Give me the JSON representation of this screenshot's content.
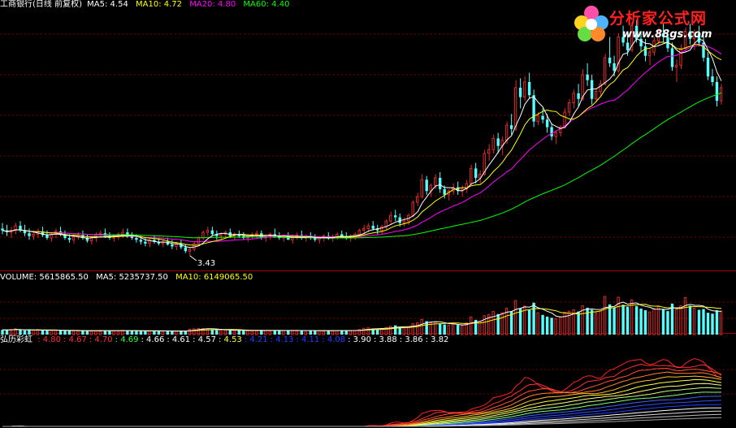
{
  "colors": {
    "background": "#000000",
    "up": "#e02a2a",
    "down": "#54ffff",
    "ma5": "#ffffff",
    "ma10": "#ffff00",
    "ma20": "#ff00ff",
    "ma60": "#00ff00",
    "grid": "#800000",
    "divider": "#a00000"
  },
  "header": {
    "title": "工商银行(日线 前复权)",
    "ma5": "MA5: 4.54",
    "ma10": "MA10: 4.72",
    "ma20": "MA20: 4.80",
    "ma60": "MA60: 4.40"
  },
  "volume_header": {
    "volume": "VOLUME: 5615865.50",
    "ma5": "MA5: 5235737.50",
    "ma10": "MA10: 6149065.50"
  },
  "indicator_header": {
    "name": "弘历彩虹",
    "values": [
      {
        "text": ": 4.80",
        "color": "#ff3030"
      },
      {
        "text": ": 4.67",
        "color": "#ff3030"
      },
      {
        "text": ": 4.70",
        "color": "#ff3030"
      },
      {
        "text": ": 4.69",
        "color": "#30ff30"
      },
      {
        "text": ": 4.66",
        "color": "#ffffff"
      },
      {
        "text": ": 4.61",
        "color": "#ffffff"
      },
      {
        "text": ": 4.57",
        "color": "#ffffff"
      },
      {
        "text": ": 4.53",
        "color": "#ffff40"
      },
      {
        "text": ": 4.21",
        "color": "#2040ff"
      },
      {
        "text": ": 4.13",
        "color": "#2040ff"
      },
      {
        "text": ": 4.11",
        "color": "#2040ff"
      },
      {
        "text": ": 4.08",
        "color": "#2040ff"
      },
      {
        "text": ": 3.90",
        "color": "#ffffff"
      },
      {
        "text": ": 3.88",
        "color": "#ffffff"
      },
      {
        "text": ": 3.86",
        "color": "#ffffff"
      },
      {
        "text": ": 3.82",
        "color": "#ffffff"
      }
    ]
  },
  "logo": {
    "title": "分析家公式网",
    "url": "www.88gs.com"
  },
  "low_label": "3.43",
  "chart_data": [
    {
      "type": "candlestick",
      "name": "price",
      "ylim": [
        3.3,
        6.05
      ],
      "low_annotation": {
        "index": 42,
        "value": 3.43,
        "label": "3.43"
      },
      "ohlc": [
        [
          3.72,
          3.78,
          3.66,
          3.7
        ],
        [
          3.7,
          3.76,
          3.64,
          3.68
        ],
        [
          3.68,
          3.74,
          3.62,
          3.7
        ],
        [
          3.7,
          3.78,
          3.66,
          3.75
        ],
        [
          3.75,
          3.8,
          3.68,
          3.7
        ],
        [
          3.7,
          3.76,
          3.64,
          3.67
        ],
        [
          3.67,
          3.72,
          3.6,
          3.64
        ],
        [
          3.64,
          3.7,
          3.6,
          3.66
        ],
        [
          3.66,
          3.72,
          3.62,
          3.69
        ],
        [
          3.69,
          3.74,
          3.63,
          3.65
        ],
        [
          3.65,
          3.7,
          3.6,
          3.62
        ],
        [
          3.62,
          3.68,
          3.58,
          3.66
        ],
        [
          3.66,
          3.72,
          3.62,
          3.69
        ],
        [
          3.69,
          3.74,
          3.64,
          3.66
        ],
        [
          3.66,
          3.7,
          3.6,
          3.62
        ],
        [
          3.62,
          3.66,
          3.57,
          3.6
        ],
        [
          3.6,
          3.66,
          3.56,
          3.63
        ],
        [
          3.63,
          3.68,
          3.6,
          3.65
        ],
        [
          3.65,
          3.7,
          3.6,
          3.62
        ],
        [
          3.62,
          3.66,
          3.57,
          3.59
        ],
        [
          3.59,
          3.64,
          3.55,
          3.62
        ],
        [
          3.62,
          3.68,
          3.58,
          3.65
        ],
        [
          3.65,
          3.7,
          3.62,
          3.67
        ],
        [
          3.67,
          3.72,
          3.62,
          3.64
        ],
        [
          3.64,
          3.68,
          3.6,
          3.62
        ],
        [
          3.62,
          3.66,
          3.58,
          3.63
        ],
        [
          3.63,
          3.68,
          3.6,
          3.66
        ],
        [
          3.66,
          3.72,
          3.62,
          3.68
        ],
        [
          3.68,
          3.72,
          3.62,
          3.64
        ],
        [
          3.64,
          3.68,
          3.6,
          3.62
        ],
        [
          3.62,
          3.66,
          3.57,
          3.6
        ],
        [
          3.6,
          3.64,
          3.55,
          3.58
        ],
        [
          3.58,
          3.62,
          3.53,
          3.56
        ],
        [
          3.56,
          3.62,
          3.52,
          3.6
        ],
        [
          3.6,
          3.65,
          3.56,
          3.58
        ],
        [
          3.58,
          3.62,
          3.54,
          3.56
        ],
        [
          3.56,
          3.6,
          3.52,
          3.58
        ],
        [
          3.58,
          3.62,
          3.54,
          3.55
        ],
        [
          3.55,
          3.6,
          3.5,
          3.53
        ],
        [
          3.53,
          3.58,
          3.49,
          3.56
        ],
        [
          3.56,
          3.6,
          3.5,
          3.52
        ],
        [
          3.52,
          3.55,
          3.46,
          3.48
        ],
        [
          3.48,
          3.52,
          3.43,
          3.5
        ],
        [
          3.5,
          3.58,
          3.48,
          3.56
        ],
        [
          3.56,
          3.64,
          3.54,
          3.62
        ],
        [
          3.62,
          3.7,
          3.6,
          3.68
        ],
        [
          3.68,
          3.74,
          3.64,
          3.7
        ],
        [
          3.7,
          3.74,
          3.64,
          3.66
        ],
        [
          3.66,
          3.7,
          3.6,
          3.64
        ],
        [
          3.64,
          3.68,
          3.6,
          3.66
        ],
        [
          3.66,
          3.7,
          3.62,
          3.68
        ],
        [
          3.68,
          3.72,
          3.62,
          3.64
        ],
        [
          3.64,
          3.68,
          3.6,
          3.66
        ],
        [
          3.66,
          3.7,
          3.62,
          3.64
        ],
        [
          3.64,
          3.68,
          3.6,
          3.62
        ],
        [
          3.62,
          3.66,
          3.58,
          3.64
        ],
        [
          3.64,
          3.68,
          3.6,
          3.66
        ],
        [
          3.66,
          3.7,
          3.62,
          3.67
        ],
        [
          3.67,
          3.7,
          3.6,
          3.62
        ],
        [
          3.62,
          3.66,
          3.58,
          3.64
        ],
        [
          3.64,
          3.68,
          3.6,
          3.66
        ],
        [
          3.66,
          3.72,
          3.62,
          3.64
        ],
        [
          3.64,
          3.68,
          3.6,
          3.62
        ],
        [
          3.62,
          3.66,
          3.58,
          3.64
        ],
        [
          3.64,
          3.68,
          3.6,
          3.6
        ],
        [
          3.6,
          3.66,
          3.56,
          3.63
        ],
        [
          3.63,
          3.68,
          3.6,
          3.65
        ],
        [
          3.65,
          3.7,
          3.6,
          3.62
        ],
        [
          3.62,
          3.66,
          3.58,
          3.64
        ],
        [
          3.64,
          3.68,
          3.6,
          3.62
        ],
        [
          3.62,
          3.66,
          3.58,
          3.6
        ],
        [
          3.6,
          3.64,
          3.56,
          3.62
        ],
        [
          3.62,
          3.66,
          3.58,
          3.64
        ],
        [
          3.64,
          3.68,
          3.6,
          3.62
        ],
        [
          3.62,
          3.66,
          3.58,
          3.63
        ],
        [
          3.63,
          3.68,
          3.6,
          3.66
        ],
        [
          3.66,
          3.7,
          3.62,
          3.64
        ],
        [
          3.64,
          3.68,
          3.6,
          3.62
        ],
        [
          3.62,
          3.66,
          3.58,
          3.64
        ],
        [
          3.64,
          3.68,
          3.6,
          3.66
        ],
        [
          3.66,
          3.72,
          3.62,
          3.7
        ],
        [
          3.7,
          3.76,
          3.66,
          3.72
        ],
        [
          3.72,
          3.78,
          3.68,
          3.75
        ],
        [
          3.75,
          3.8,
          3.7,
          3.72
        ],
        [
          3.72,
          3.76,
          3.66,
          3.7
        ],
        [
          3.7,
          3.76,
          3.66,
          3.74
        ],
        [
          3.74,
          3.82,
          3.7,
          3.8
        ],
        [
          3.8,
          3.9,
          3.76,
          3.86
        ],
        [
          3.86,
          3.92,
          3.8,
          3.84
        ],
        [
          3.84,
          3.88,
          3.74,
          3.78
        ],
        [
          3.78,
          3.84,
          3.74,
          3.8
        ],
        [
          3.8,
          3.88,
          3.76,
          3.86
        ],
        [
          3.86,
          4.02,
          3.84,
          4.0
        ],
        [
          4.0,
          4.1,
          3.96,
          4.06
        ],
        [
          4.06,
          4.3,
          4.04,
          4.24
        ],
        [
          4.24,
          4.28,
          4.08,
          4.12
        ],
        [
          4.12,
          4.2,
          4.06,
          4.18
        ],
        [
          4.18,
          4.3,
          4.14,
          4.26
        ],
        [
          4.26,
          4.32,
          4.1,
          4.14
        ],
        [
          4.14,
          4.18,
          4.04,
          4.08
        ],
        [
          4.08,
          4.14,
          4.02,
          4.12
        ],
        [
          4.12,
          4.2,
          4.08,
          4.16
        ],
        [
          4.16,
          4.22,
          4.08,
          4.12
        ],
        [
          4.12,
          4.18,
          4.06,
          4.14
        ],
        [
          4.14,
          4.24,
          4.1,
          4.2
        ],
        [
          4.2,
          4.4,
          4.18,
          4.36
        ],
        [
          4.36,
          4.42,
          4.2,
          4.26
        ],
        [
          4.26,
          4.34,
          4.2,
          4.3
        ],
        [
          4.3,
          4.56,
          4.28,
          4.52
        ],
        [
          4.52,
          4.62,
          4.44,
          4.56
        ],
        [
          4.56,
          4.72,
          4.52,
          4.68
        ],
        [
          4.68,
          4.74,
          4.52,
          4.6
        ],
        [
          4.6,
          4.7,
          4.5,
          4.66
        ],
        [
          4.66,
          4.86,
          4.62,
          4.82
        ],
        [
          4.82,
          4.94,
          4.72,
          4.78
        ],
        [
          4.78,
          5.3,
          4.76,
          5.22
        ],
        [
          5.22,
          5.32,
          5.0,
          5.12
        ],
        [
          5.12,
          5.34,
          5.08,
          5.28
        ],
        [
          5.28,
          5.38,
          5.1,
          5.14
        ],
        [
          5.14,
          5.2,
          4.8,
          4.86
        ],
        [
          4.86,
          4.96,
          4.82,
          4.92
        ],
        [
          4.92,
          5.0,
          4.84,
          4.88
        ],
        [
          4.88,
          4.94,
          4.74,
          4.8
        ],
        [
          4.8,
          4.84,
          4.66,
          4.7
        ],
        [
          4.7,
          4.76,
          4.62,
          4.74
        ],
        [
          4.74,
          4.82,
          4.7,
          4.8
        ],
        [
          4.8,
          5.0,
          4.78,
          4.96
        ],
        [
          4.96,
          5.1,
          4.92,
          5.06
        ],
        [
          5.06,
          5.2,
          5.0,
          5.16
        ],
        [
          5.16,
          5.26,
          5.02,
          5.1
        ],
        [
          5.1,
          5.42,
          5.08,
          5.36
        ],
        [
          5.36,
          5.48,
          5.24,
          5.3
        ],
        [
          5.3,
          5.36,
          5.04,
          5.1
        ],
        [
          5.1,
          5.22,
          5.06,
          5.18
        ],
        [
          5.18,
          5.3,
          5.12,
          5.26
        ],
        [
          5.26,
          5.58,
          5.24,
          5.54
        ],
        [
          5.54,
          5.76,
          5.44,
          5.48
        ],
        [
          5.48,
          5.56,
          5.34,
          5.4
        ],
        [
          5.4,
          5.8,
          5.38,
          5.76
        ],
        [
          5.76,
          5.88,
          5.66,
          5.7
        ],
        [
          5.7,
          5.82,
          5.56,
          5.62
        ],
        [
          5.62,
          5.92,
          5.6,
          5.88
        ],
        [
          5.88,
          5.94,
          5.7,
          5.74
        ],
        [
          5.74,
          5.82,
          5.6,
          5.66
        ],
        [
          5.66,
          5.74,
          5.5,
          5.56
        ],
        [
          5.56,
          5.64,
          5.46,
          5.6
        ],
        [
          5.6,
          5.76,
          5.56,
          5.72
        ],
        [
          5.72,
          5.86,
          5.66,
          5.8
        ],
        [
          5.8,
          5.9,
          5.7,
          5.76
        ],
        [
          5.76,
          5.8,
          5.6,
          5.64
        ],
        [
          5.64,
          5.7,
          5.4,
          5.44
        ],
        [
          5.44,
          5.52,
          5.28,
          5.46
        ],
        [
          5.46,
          5.68,
          5.42,
          5.64
        ],
        [
          5.64,
          5.86,
          5.6,
          5.82
        ],
        [
          5.82,
          5.9,
          5.68,
          5.74
        ],
        [
          5.74,
          5.84,
          5.62,
          5.8
        ],
        [
          5.8,
          5.88,
          5.66,
          5.7
        ],
        [
          5.7,
          5.78,
          5.5,
          5.54
        ],
        [
          5.54,
          5.6,
          5.3,
          5.34
        ],
        [
          5.34,
          5.42,
          5.24,
          5.28
        ],
        [
          5.28,
          5.34,
          5.02,
          5.08
        ],
        [
          5.08,
          5.26,
          5.04,
          5.22
        ]
      ]
    },
    {
      "type": "bar",
      "name": "volume",
      "ylim": [
        0,
        12000000
      ],
      "ma": [
        {
          "name": "MA5",
          "value": 5235737.5
        },
        {
          "name": "MA10",
          "value": 6149065.5
        }
      ],
      "values": [
        1150000,
        1080000,
        1220000,
        1350000,
        1120000,
        980000,
        1100000,
        1050000,
        1180000,
        1000000,
        950000,
        1020000,
        1100000,
        980000,
        900000,
        880000,
        940000,
        1000000,
        920000,
        870000,
        900000,
        960000,
        1020000,
        980000,
        920000,
        900000,
        940000,
        1000000,
        960000,
        910000,
        880000,
        860000,
        840000,
        900000,
        880000,
        850000,
        870000,
        840000,
        820000,
        860000,
        830000,
        800000,
        1300000,
        1400000,
        1500000,
        1450000,
        1380000,
        1200000,
        1100000,
        1050000,
        1080000,
        1000000,
        1020000,
        980000,
        950000,
        970000,
        1000000,
        1020000,
        980000,
        950000,
        990000,
        1010000,
        970000,
        960000,
        930000,
        980000,
        1000000,
        960000,
        950000,
        940000,
        920000,
        950000,
        980000,
        960000,
        940000,
        970000,
        990000,
        960000,
        950000,
        980000,
        1200000,
        1500000,
        1600000,
        1450000,
        1300000,
        1400000,
        1700000,
        2000000,
        2200000,
        1800000,
        1600000,
        1900000,
        2600000,
        2800000,
        3600000,
        3200000,
        2800000,
        3000000,
        2700000,
        2400000,
        2200000,
        2500000,
        2300000,
        2100000,
        2800000,
        4200000,
        3500000,
        3200000,
        4500000,
        4800000,
        5500000,
        4900000,
        5200000,
        6300000,
        5600000,
        8100000,
        6200000,
        6800000,
        6000000,
        7600000,
        5200000,
        4700000,
        4300000,
        4000000,
        3800000,
        4200000,
        5300000,
        5600000,
        5900000,
        5500000,
        6900000,
        6400000,
        5900000,
        5200000,
        5600000,
        9100000,
        7200000,
        6400000,
        8900000,
        7100000,
        6600000,
        8300000,
        6800000,
        6200000,
        5800000,
        5400000,
        6200000,
        6700000,
        6100000,
        5600000,
        7400000,
        6000000,
        6900000,
        8800000,
        6900000,
        6300000,
        5900000,
        6100000,
        5200000,
        5000000,
        5800000,
        5615865
      ]
    },
    {
      "type": "line",
      "name": "rainbow",
      "ylim": [
        0,
        8
      ]
    }
  ]
}
